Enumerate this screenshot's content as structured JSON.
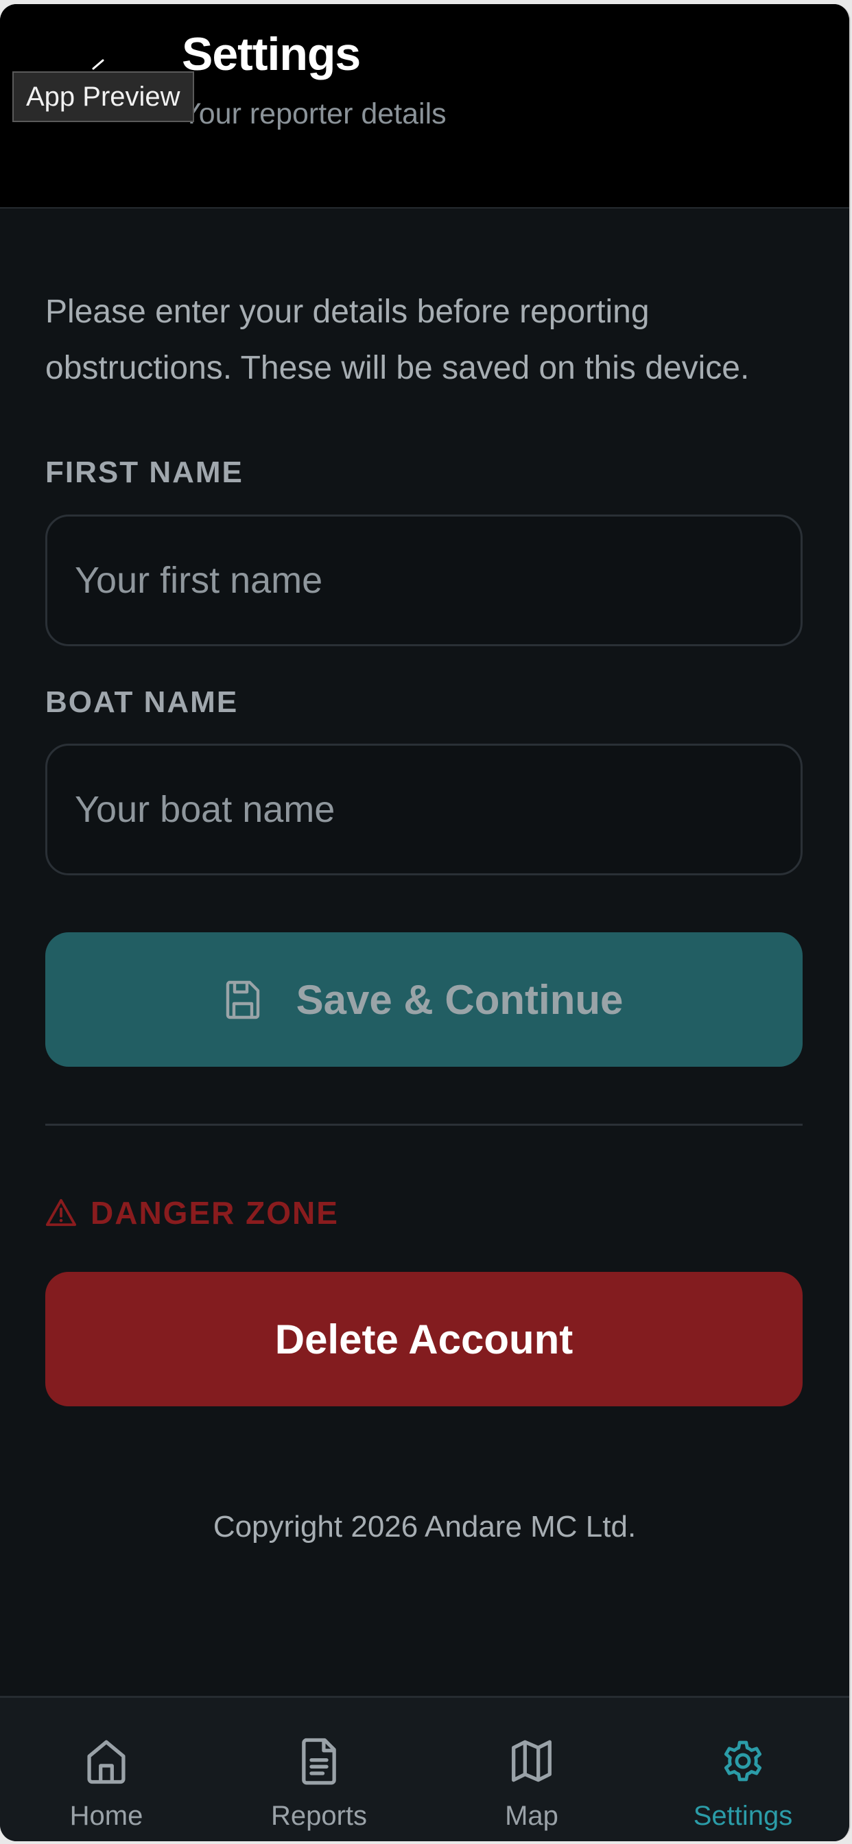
{
  "header": {
    "title": "Settings",
    "subtitle": "Your reporter details",
    "preview_tag": "App Preview"
  },
  "intro": "Please enter your details before reporting obstructions. These will be saved on this device.",
  "form": {
    "first_name_label": "FIRST NAME",
    "first_name_placeholder": "Your first name",
    "first_name_value": "",
    "boat_name_label": "BOAT NAME",
    "boat_name_placeholder": "Your boat name",
    "boat_name_value": "",
    "save_label": "Save & Continue",
    "save_icon": "save-icon"
  },
  "danger_zone": {
    "label": "DANGER ZONE",
    "icon": "warning-icon",
    "delete_label": "Delete Account"
  },
  "copyright": "Copyright 2026 Andare MC Ltd.",
  "nav": {
    "items": [
      {
        "label": "Home",
        "icon": "home-icon"
      },
      {
        "label": "Reports",
        "icon": "document-icon"
      },
      {
        "label": "Map",
        "icon": "map-icon"
      },
      {
        "label": "Settings",
        "icon": "gear-icon",
        "active": true
      }
    ]
  },
  "colors": {
    "accent": "#2b9ca8",
    "save_button": "#225e63",
    "danger": "#831c1f",
    "background": "#0f1316"
  }
}
